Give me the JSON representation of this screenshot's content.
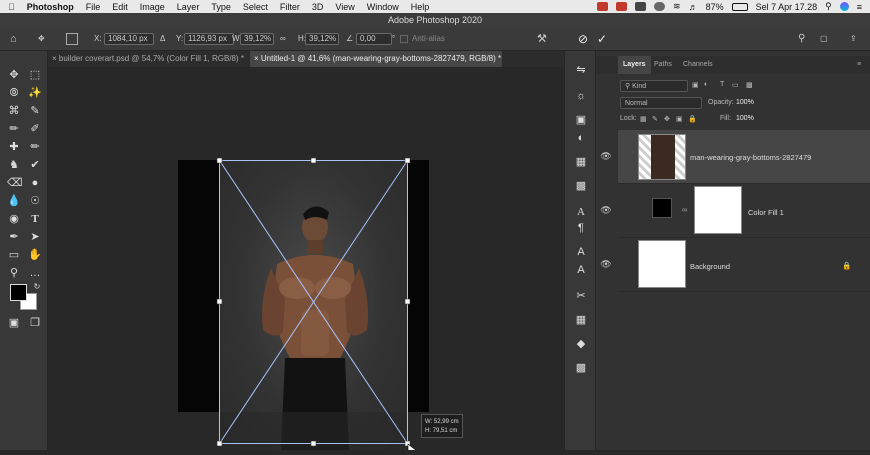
{
  "menubar": {
    "apple": "",
    "app_name": "Photoshop",
    "items": [
      "File",
      "Edit",
      "Image",
      "Layer",
      "Type",
      "Select",
      "Filter",
      "3D",
      "View",
      "Window",
      "Help"
    ],
    "battery": "87%",
    "datetime": "Sel 7 Apr  17.28"
  },
  "window": {
    "title": "Adobe Photoshop 2020"
  },
  "options": {
    "x_label": "X:",
    "x_value": "1084,10 px",
    "y_label": "Y:",
    "y_value": "1126,93 px",
    "w_label": "W:",
    "w_value": "39,12%",
    "h_label": "H:",
    "h_value": "39,12%",
    "angle_value": "0,00",
    "degree": "°",
    "antialias": "Anti-alias"
  },
  "tabs": [
    {
      "label": "builder coverart.psd @ 54,7% (Color Fill 1, RGB/8) *"
    },
    {
      "label": "Untitled-1 @ 41,6% (man-wearing-gray-bottoms-2827479, RGB/8) *"
    }
  ],
  "transform_tooltip": {
    "w": "W: 52,99 cm",
    "h": "H: 79,51 cm"
  },
  "panel": {
    "tabs": [
      "Layers",
      "Paths",
      "Channels"
    ],
    "kind": "Kind",
    "blend_mode": "Normal",
    "opacity_label": "Opacity:",
    "opacity_value": "100%",
    "lock_label": "Lock:",
    "fill_label": "Fill:",
    "fill_value": "100%",
    "layers": [
      {
        "name": "man-wearing-gray-bottoms-2827479"
      },
      {
        "name": "Color Fill 1"
      },
      {
        "name": "Background"
      }
    ]
  },
  "colors": {
    "accent": "#1473e6",
    "fg_swatch": "#000000",
    "bg_swatch": "#ffffff"
  }
}
